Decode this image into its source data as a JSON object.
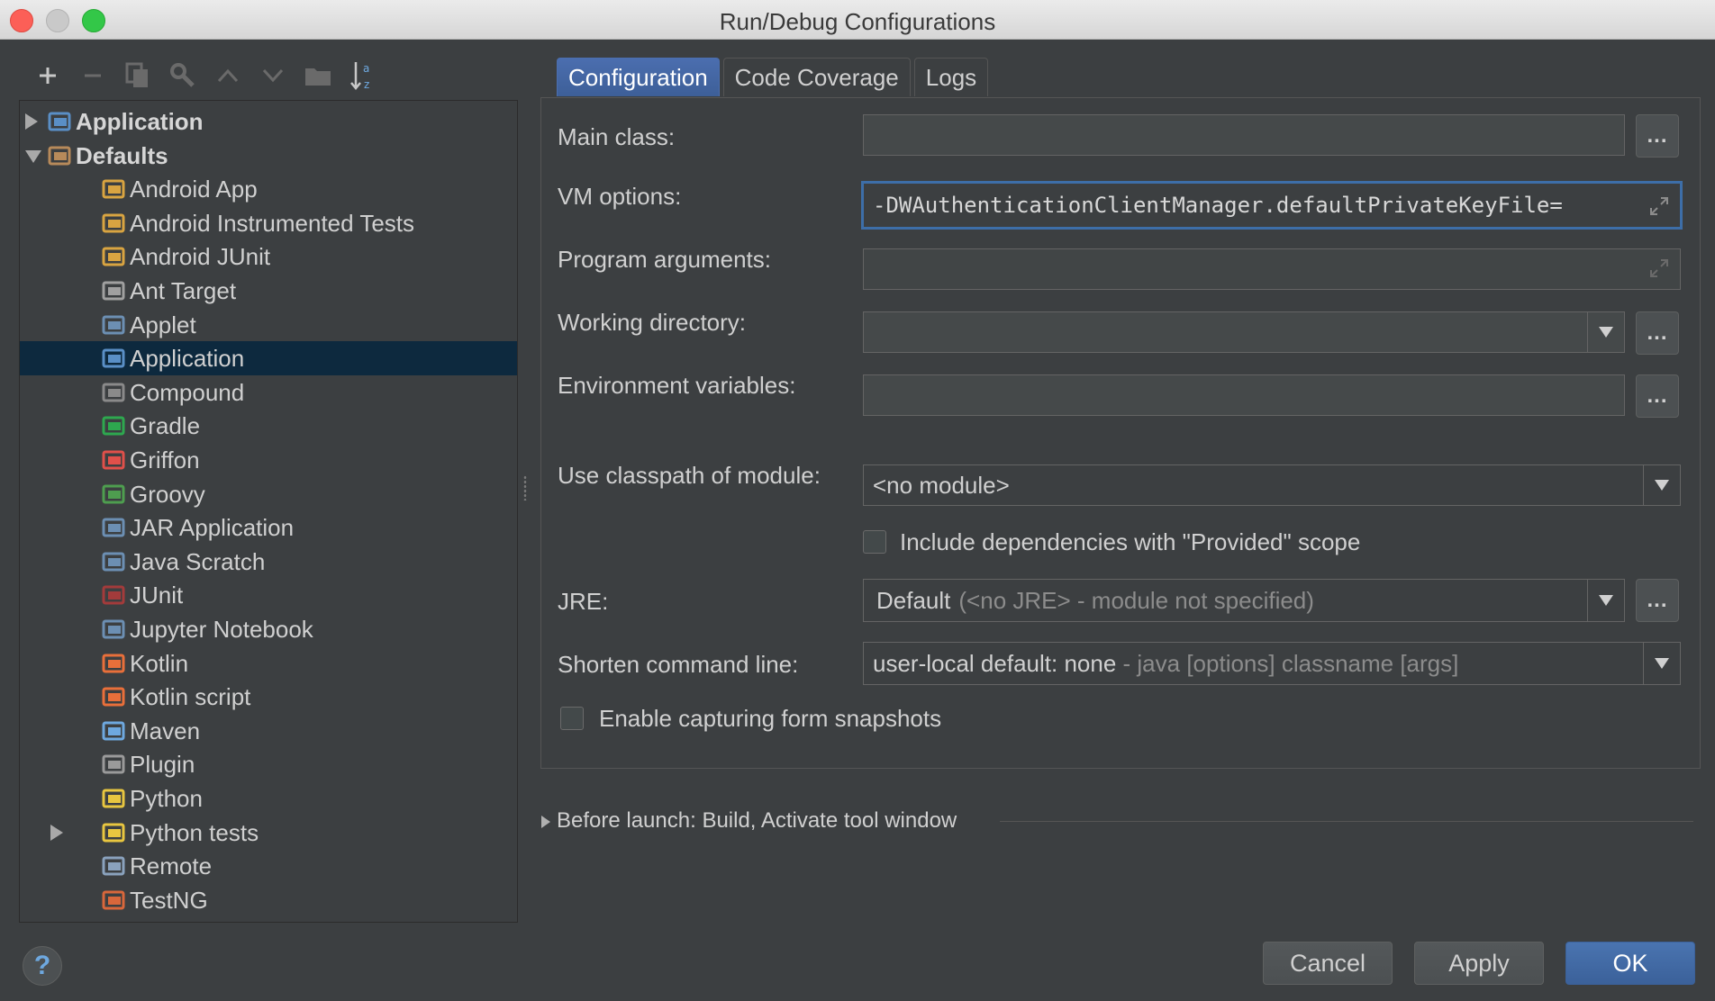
{
  "window": {
    "title": "Run/Debug Configurations"
  },
  "toolbar": {
    "buttons": [
      "add-icon",
      "remove-icon",
      "copy-icon",
      "edit-defaults-icon",
      "move-up-icon",
      "move-down-icon",
      "folder-icon",
      "sort-icon"
    ]
  },
  "tree": {
    "items": [
      {
        "label": "Application",
        "level": 0,
        "bold": true,
        "expander": "collapsed",
        "icon": "application-icon"
      },
      {
        "label": "Defaults",
        "level": 0,
        "bold": true,
        "expander": "expanded",
        "icon": "defaults-wrench-icon"
      },
      {
        "label": "Android App",
        "level": 1,
        "icon": "android-app-icon"
      },
      {
        "label": "Android Instrumented Tests",
        "level": 1,
        "icon": "android-tests-icon"
      },
      {
        "label": "Android JUnit",
        "level": 1,
        "icon": "android-junit-icon"
      },
      {
        "label": "Ant Target",
        "level": 1,
        "icon": "ant-icon"
      },
      {
        "label": "Applet",
        "level": 1,
        "icon": "applet-icon"
      },
      {
        "label": "Application",
        "level": 1,
        "icon": "application-icon",
        "selected": true
      },
      {
        "label": "Compound",
        "level": 1,
        "icon": "compound-icon"
      },
      {
        "label": "Gradle",
        "level": 1,
        "icon": "gradle-icon"
      },
      {
        "label": "Griffon",
        "level": 1,
        "icon": "griffon-icon"
      },
      {
        "label": "Groovy",
        "level": 1,
        "icon": "groovy-icon"
      },
      {
        "label": "JAR Application",
        "level": 1,
        "icon": "jar-icon"
      },
      {
        "label": "Java Scratch",
        "level": 1,
        "icon": "java-scratch-icon"
      },
      {
        "label": "JUnit",
        "level": 1,
        "icon": "junit-icon"
      },
      {
        "label": "Jupyter Notebook",
        "level": 1,
        "icon": "jupyter-icon"
      },
      {
        "label": "Kotlin",
        "level": 1,
        "icon": "kotlin-icon"
      },
      {
        "label": "Kotlin script",
        "level": 1,
        "icon": "kotlin-icon"
      },
      {
        "label": "Maven",
        "level": 1,
        "icon": "maven-gear-icon"
      },
      {
        "label": "Plugin",
        "level": 1,
        "icon": "plugin-icon"
      },
      {
        "label": "Python",
        "level": 1,
        "icon": "python-icon"
      },
      {
        "label": "Python tests",
        "level": 1,
        "icon": "python-icon",
        "expander": "collapsed"
      },
      {
        "label": "Remote",
        "level": 1,
        "icon": "remote-icon"
      },
      {
        "label": "TestNG",
        "level": 1,
        "icon": "testng-icon"
      }
    ]
  },
  "tabs": [
    {
      "label": "Configuration",
      "active": true
    },
    {
      "label": "Code Coverage",
      "active": false
    },
    {
      "label": "Logs",
      "active": false
    }
  ],
  "form": {
    "main_class": {
      "label": "Main class:",
      "value": ""
    },
    "vm_options": {
      "label": "VM options:",
      "value": "-DWAuthenticationClientManager.defaultPrivateKeyFile="
    },
    "program_arguments": {
      "label": "Program arguments:",
      "value": ""
    },
    "working_directory": {
      "label": "Working directory:",
      "value": ""
    },
    "environment_variables": {
      "label": "Environment variables:",
      "value": ""
    },
    "classpath_module": {
      "label": "Use classpath of module:",
      "value": "<no module>"
    },
    "include_provided": {
      "label": "Include dependencies with \"Provided\" scope",
      "checked": false
    },
    "jre": {
      "label": "JRE:",
      "value_main": "Default",
      "value_hint": "(<no JRE> - module not specified)"
    },
    "shorten_cmd": {
      "label": "Shorten command line:",
      "value_main": "user-local default: none",
      "value_hint": " - java [options] classname [args]"
    },
    "form_snapshots": {
      "label": "Enable capturing form snapshots",
      "checked": false
    },
    "browse_label": "..."
  },
  "before_launch": {
    "label": "Before launch: Build, Activate tool window"
  },
  "buttons": {
    "help": "?",
    "cancel": "Cancel",
    "apply": "Apply",
    "ok": "OK"
  }
}
